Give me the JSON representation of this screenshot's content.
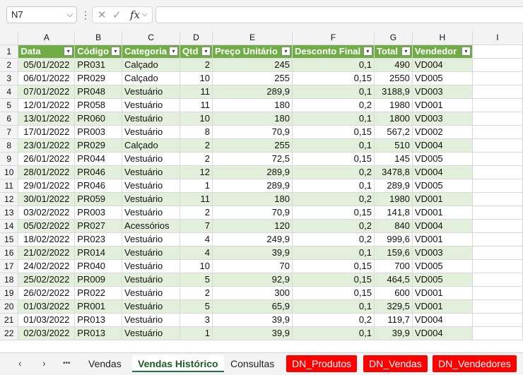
{
  "formula_bar": {
    "name_box": "N7",
    "more_icon": "⋮",
    "cancel_icon": "✕",
    "enter_icon": "✓",
    "fx_label": "fx",
    "formula": ""
  },
  "columns": [
    "A",
    "B",
    "C",
    "D",
    "E",
    "F",
    "G",
    "H",
    "I"
  ],
  "row_numbers": [
    "1",
    "2",
    "3",
    "4",
    "5",
    "6",
    "7",
    "8",
    "9",
    "10",
    "11",
    "12",
    "13",
    "14",
    "15",
    "16",
    "17",
    "18",
    "19",
    "20",
    "21",
    "22"
  ],
  "table": {
    "header_color": "#70ad47",
    "band_color": "#e2efda",
    "headers": [
      "Data",
      "Código",
      "Categoria",
      "Qtd",
      "Preço Unitário",
      "Desconto Final",
      "Total",
      "Vendedor"
    ],
    "rows": [
      [
        "05/01/2022",
        "PR031",
        "Calçado",
        "2",
        "245",
        "0,1",
        "490",
        "VD004"
      ],
      [
        "06/01/2022",
        "PR029",
        "Calçado",
        "10",
        "255",
        "0,15",
        "2550",
        "VD005"
      ],
      [
        "07/01/2022",
        "PR048",
        "Vestuário",
        "11",
        "289,9",
        "0,1",
        "3188,9",
        "VD003"
      ],
      [
        "12/01/2022",
        "PR058",
        "Vestuário",
        "11",
        "180",
        "0,2",
        "1980",
        "VD001"
      ],
      [
        "13/01/2022",
        "PR060",
        "Vestuário",
        "10",
        "180",
        "0,1",
        "1800",
        "VD003"
      ],
      [
        "17/01/2022",
        "PR003",
        "Vestuário",
        "8",
        "70,9",
        "0,15",
        "567,2",
        "VD002"
      ],
      [
        "23/01/2022",
        "PR029",
        "Calçado",
        "2",
        "255",
        "0,1",
        "510",
        "VD004"
      ],
      [
        "26/01/2022",
        "PR044",
        "Vestuário",
        "2",
        "72,5",
        "0,15",
        "145",
        "VD005"
      ],
      [
        "28/01/2022",
        "PR046",
        "Vestuário",
        "12",
        "289,9",
        "0,2",
        "3478,8",
        "VD004"
      ],
      [
        "29/01/2022",
        "PR046",
        "Vestuário",
        "1",
        "289,9",
        "0,1",
        "289,9",
        "VD005"
      ],
      [
        "30/01/2022",
        "PR059",
        "Vestuário",
        "11",
        "180",
        "0,2",
        "1980",
        "VD001"
      ],
      [
        "03/02/2022",
        "PR003",
        "Vestuário",
        "2",
        "70,9",
        "0,15",
        "141,8",
        "VD001"
      ],
      [
        "05/02/2022",
        "PR027",
        "Acessórios",
        "7",
        "120",
        "0,2",
        "840",
        "VD004"
      ],
      [
        "18/02/2022",
        "PR023",
        "Vestuário",
        "4",
        "249,9",
        "0,2",
        "999,6",
        "VD001"
      ],
      [
        "21/02/2022",
        "PR014",
        "Vestuário",
        "4",
        "39,9",
        "0,1",
        "159,6",
        "VD003"
      ],
      [
        "24/02/2022",
        "PR040",
        "Vestuário",
        "10",
        "70",
        "0,15",
        "700",
        "VD005"
      ],
      [
        "25/02/2022",
        "PR009",
        "Vestuário",
        "5",
        "92,9",
        "0,15",
        "464,5",
        "VD005"
      ],
      [
        "26/02/2022",
        "PR022",
        "Vestuário",
        "2",
        "300",
        "0,15",
        "600",
        "VD001"
      ],
      [
        "01/03/2022",
        "PR001",
        "Vestuário",
        "5",
        "65,9",
        "0,1",
        "329,5",
        "VD001"
      ],
      [
        "01/03/2022",
        "PR013",
        "Vestuário",
        "3",
        "39,9",
        "0,2",
        "119,7",
        "VD004"
      ],
      [
        "02/03/2022",
        "PR013",
        "Vestuário",
        "1",
        "39,9",
        "0,1",
        "39,9",
        "VD004"
      ]
    ]
  },
  "sheet_tabs": {
    "prev_icon": "‹",
    "next_icon": "›",
    "more_icon": "•••",
    "tabs": [
      {
        "label": "Vendas",
        "style": "normal"
      },
      {
        "label": "Vendas Histórico",
        "style": "active"
      },
      {
        "label": "Consultas",
        "style": "normal"
      },
      {
        "label": "DN_Produtos",
        "style": "red"
      },
      {
        "label": "DN_Vendas",
        "style": "red"
      },
      {
        "label": "DN_Vendedores",
        "style": "red"
      }
    ],
    "red_color": "#ff0000"
  }
}
